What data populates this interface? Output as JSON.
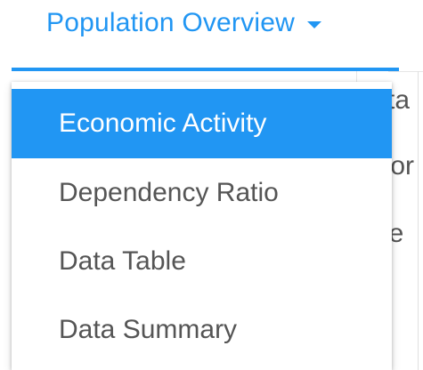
{
  "dropdown": {
    "label": "Population Overview",
    "accent_color": "#2196f3",
    "caret_icon": "caret-down-icon"
  },
  "menu": {
    "items": [
      {
        "label": "Economic Activity",
        "active": true
      },
      {
        "label": "Dependency Ratio",
        "active": false
      },
      {
        "label": "Data Table",
        "active": false
      },
      {
        "label": "Data Summary",
        "active": false
      }
    ]
  },
  "background": {
    "fragments": [
      "sta",
      "Vor",
      "ne"
    ]
  }
}
